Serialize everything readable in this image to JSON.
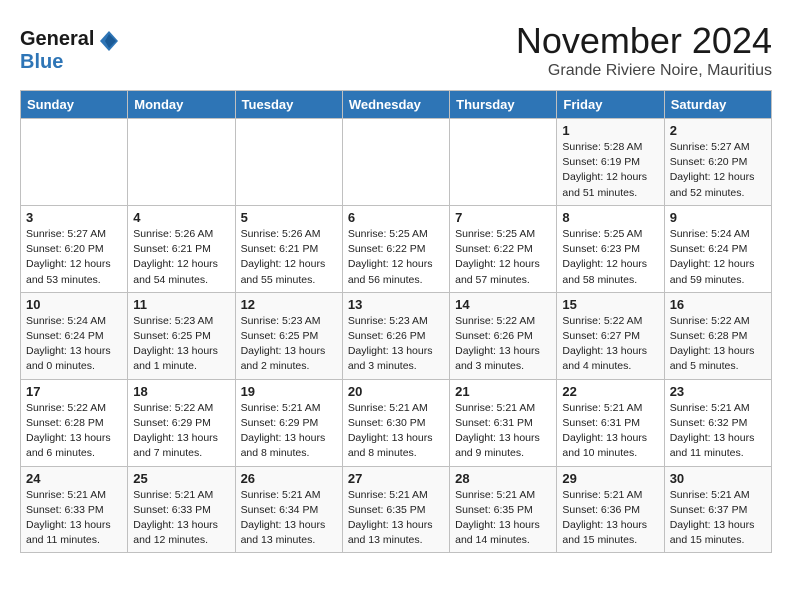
{
  "logo": {
    "general": "General",
    "blue": "Blue"
  },
  "header": {
    "month": "November 2024",
    "location": "Grande Riviere Noire, Mauritius"
  },
  "weekdays": [
    "Sunday",
    "Monday",
    "Tuesday",
    "Wednesday",
    "Thursday",
    "Friday",
    "Saturday"
  ],
  "weeks": [
    [
      {
        "day": "",
        "info": ""
      },
      {
        "day": "",
        "info": ""
      },
      {
        "day": "",
        "info": ""
      },
      {
        "day": "",
        "info": ""
      },
      {
        "day": "",
        "info": ""
      },
      {
        "day": "1",
        "info": "Sunrise: 5:28 AM\nSunset: 6:19 PM\nDaylight: 12 hours\nand 51 minutes."
      },
      {
        "day": "2",
        "info": "Sunrise: 5:27 AM\nSunset: 6:20 PM\nDaylight: 12 hours\nand 52 minutes."
      }
    ],
    [
      {
        "day": "3",
        "info": "Sunrise: 5:27 AM\nSunset: 6:20 PM\nDaylight: 12 hours\nand 53 minutes."
      },
      {
        "day": "4",
        "info": "Sunrise: 5:26 AM\nSunset: 6:21 PM\nDaylight: 12 hours\nand 54 minutes."
      },
      {
        "day": "5",
        "info": "Sunrise: 5:26 AM\nSunset: 6:21 PM\nDaylight: 12 hours\nand 55 minutes."
      },
      {
        "day": "6",
        "info": "Sunrise: 5:25 AM\nSunset: 6:22 PM\nDaylight: 12 hours\nand 56 minutes."
      },
      {
        "day": "7",
        "info": "Sunrise: 5:25 AM\nSunset: 6:22 PM\nDaylight: 12 hours\nand 57 minutes."
      },
      {
        "day": "8",
        "info": "Sunrise: 5:25 AM\nSunset: 6:23 PM\nDaylight: 12 hours\nand 58 minutes."
      },
      {
        "day": "9",
        "info": "Sunrise: 5:24 AM\nSunset: 6:24 PM\nDaylight: 12 hours\nand 59 minutes."
      }
    ],
    [
      {
        "day": "10",
        "info": "Sunrise: 5:24 AM\nSunset: 6:24 PM\nDaylight: 13 hours\nand 0 minutes."
      },
      {
        "day": "11",
        "info": "Sunrise: 5:23 AM\nSunset: 6:25 PM\nDaylight: 13 hours\nand 1 minute."
      },
      {
        "day": "12",
        "info": "Sunrise: 5:23 AM\nSunset: 6:25 PM\nDaylight: 13 hours\nand 2 minutes."
      },
      {
        "day": "13",
        "info": "Sunrise: 5:23 AM\nSunset: 6:26 PM\nDaylight: 13 hours\nand 3 minutes."
      },
      {
        "day": "14",
        "info": "Sunrise: 5:22 AM\nSunset: 6:26 PM\nDaylight: 13 hours\nand 3 minutes."
      },
      {
        "day": "15",
        "info": "Sunrise: 5:22 AM\nSunset: 6:27 PM\nDaylight: 13 hours\nand 4 minutes."
      },
      {
        "day": "16",
        "info": "Sunrise: 5:22 AM\nSunset: 6:28 PM\nDaylight: 13 hours\nand 5 minutes."
      }
    ],
    [
      {
        "day": "17",
        "info": "Sunrise: 5:22 AM\nSunset: 6:28 PM\nDaylight: 13 hours\nand 6 minutes."
      },
      {
        "day": "18",
        "info": "Sunrise: 5:22 AM\nSunset: 6:29 PM\nDaylight: 13 hours\nand 7 minutes."
      },
      {
        "day": "19",
        "info": "Sunrise: 5:21 AM\nSunset: 6:29 PM\nDaylight: 13 hours\nand 8 minutes."
      },
      {
        "day": "20",
        "info": "Sunrise: 5:21 AM\nSunset: 6:30 PM\nDaylight: 13 hours\nand 8 minutes."
      },
      {
        "day": "21",
        "info": "Sunrise: 5:21 AM\nSunset: 6:31 PM\nDaylight: 13 hours\nand 9 minutes."
      },
      {
        "day": "22",
        "info": "Sunrise: 5:21 AM\nSunset: 6:31 PM\nDaylight: 13 hours\nand 10 minutes."
      },
      {
        "day": "23",
        "info": "Sunrise: 5:21 AM\nSunset: 6:32 PM\nDaylight: 13 hours\nand 11 minutes."
      }
    ],
    [
      {
        "day": "24",
        "info": "Sunrise: 5:21 AM\nSunset: 6:33 PM\nDaylight: 13 hours\nand 11 minutes."
      },
      {
        "day": "25",
        "info": "Sunrise: 5:21 AM\nSunset: 6:33 PM\nDaylight: 13 hours\nand 12 minutes."
      },
      {
        "day": "26",
        "info": "Sunrise: 5:21 AM\nSunset: 6:34 PM\nDaylight: 13 hours\nand 13 minutes."
      },
      {
        "day": "27",
        "info": "Sunrise: 5:21 AM\nSunset: 6:35 PM\nDaylight: 13 hours\nand 13 minutes."
      },
      {
        "day": "28",
        "info": "Sunrise: 5:21 AM\nSunset: 6:35 PM\nDaylight: 13 hours\nand 14 minutes."
      },
      {
        "day": "29",
        "info": "Sunrise: 5:21 AM\nSunset: 6:36 PM\nDaylight: 13 hours\nand 15 minutes."
      },
      {
        "day": "30",
        "info": "Sunrise: 5:21 AM\nSunset: 6:37 PM\nDaylight: 13 hours\nand 15 minutes."
      }
    ]
  ]
}
